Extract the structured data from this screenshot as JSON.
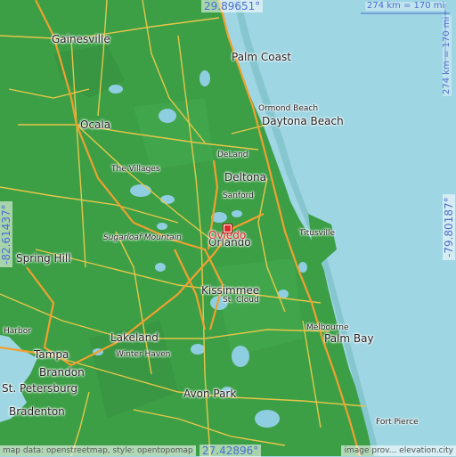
{
  "map": {
    "top_coord": "29.89651°",
    "bottom_coord": "27.42896°",
    "left_coord": "-82.61437°",
    "right_coord": "-79.80187°",
    "scale_top": "274 km = 170 mi",
    "scale_right": "274 km = 170 mi",
    "selected_city": "Oviedo",
    "cities": [
      {
        "key": "gainesville",
        "label": "Gainesville"
      },
      {
        "key": "palm_coast",
        "label": "Palm Coast"
      },
      {
        "key": "ocala",
        "label": "Ocala"
      },
      {
        "key": "ormond_beach",
        "label": "Ormond Beach"
      },
      {
        "key": "daytona_beach",
        "label": "Daytona Beach"
      },
      {
        "key": "deland",
        "label": "DeLand"
      },
      {
        "key": "the_villages",
        "label": "The Villages"
      },
      {
        "key": "deltona",
        "label": "Deltona"
      },
      {
        "key": "sanford",
        "label": "Sanford"
      },
      {
        "key": "titusville",
        "label": "Titusville"
      },
      {
        "key": "sugarloaf",
        "label": "Sugarloaf Mountain"
      },
      {
        "key": "orlando",
        "label": "Orlando"
      },
      {
        "key": "spring_hill",
        "label": "Spring Hill"
      },
      {
        "key": "kissimmee",
        "label": "Kissimmee"
      },
      {
        "key": "st_cloud",
        "label": "St. Cloud"
      },
      {
        "key": "harbor",
        "label": "Harbor"
      },
      {
        "key": "melbourne",
        "label": "Melbourne"
      },
      {
        "key": "palm_bay",
        "label": "Palm Bay"
      },
      {
        "key": "lakeland",
        "label": "Lakeland"
      },
      {
        "key": "tampa",
        "label": "Tampa"
      },
      {
        "key": "winter_haven",
        "label": "Winter Haven"
      },
      {
        "key": "brandon",
        "label": "Brandon"
      },
      {
        "key": "st_petersburg",
        "label": "St. Petersburg"
      },
      {
        "key": "avon_park",
        "label": "Avon Park"
      },
      {
        "key": "bradenton",
        "label": "Bradenton"
      },
      {
        "key": "fort_pierce",
        "label": "Fort Pierce"
      }
    ],
    "attribution_left": "map data: openstreetmap, style: opentopomap",
    "attribution_right": "image prov... elevation.city",
    "colors": {
      "land": "#3a9e47",
      "water": "#9fd6e3",
      "road": "#e8c84a",
      "highway": "#f0a030",
      "marker": "#e0252b",
      "coord": "#4c6fd0"
    }
  }
}
